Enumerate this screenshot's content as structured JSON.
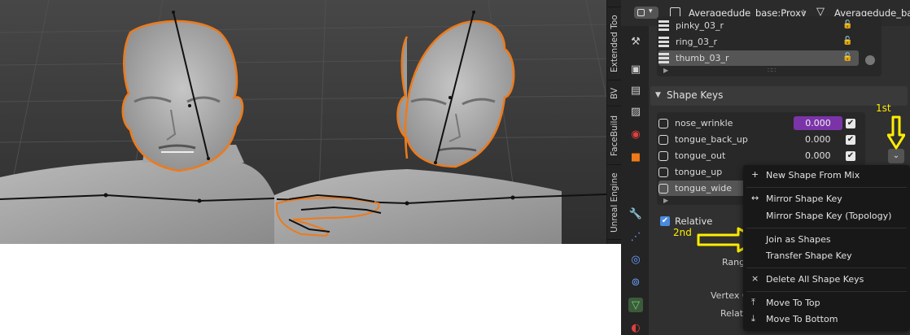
{
  "side_tabs": [
    "Extended Too",
    "BV",
    "FaceBuild",
    "Unreal Engine"
  ],
  "header": {
    "object_name": "Averagedude_base:Proxy",
    "mesh_name": "Averagedude_base"
  },
  "bone_list": [
    {
      "label": "pinky_03_r"
    },
    {
      "label": "ring_03_r"
    },
    {
      "label": "thumb_03_r"
    }
  ],
  "shape_keys": {
    "title": "Shape Keys",
    "rows": [
      {
        "label": "nose_wrinkle",
        "value": "0.000"
      },
      {
        "label": "tongue_back_up",
        "value": "0.000"
      },
      {
        "label": "tongue_out",
        "value": "0.000"
      },
      {
        "label": "tongue_up",
        "value": ""
      },
      {
        "label": "tongue_wide",
        "value": ""
      }
    ],
    "relative_label": "Relative",
    "hidden_labels": {
      "range": "Rang",
      "vertex": "Vertex G",
      "relative": "Relati"
    }
  },
  "annotations": {
    "first": "1st",
    "second": "2nd"
  },
  "context_menu": {
    "items": [
      {
        "label": "New Shape From Mix",
        "icon": "+"
      },
      {
        "label": "Mirror Shape Key",
        "icon": "↔"
      },
      {
        "label": "Mirror Shape Key (Topology)",
        "icon": ""
      },
      {
        "label": "Join as Shapes",
        "icon": ""
      },
      {
        "label": "Transfer Shape Key",
        "icon": ""
      },
      {
        "label": "Delete All Shape Keys",
        "icon": "×"
      },
      {
        "label": "Move To Top",
        "icon": "⤒"
      },
      {
        "label": "Move To Bottom",
        "icon": "⤓"
      }
    ]
  },
  "colors": {
    "accent_orange": "#ee7a1a",
    "highlight_purple": "#7b34a8",
    "annotation_yellow": "#ffee00"
  }
}
